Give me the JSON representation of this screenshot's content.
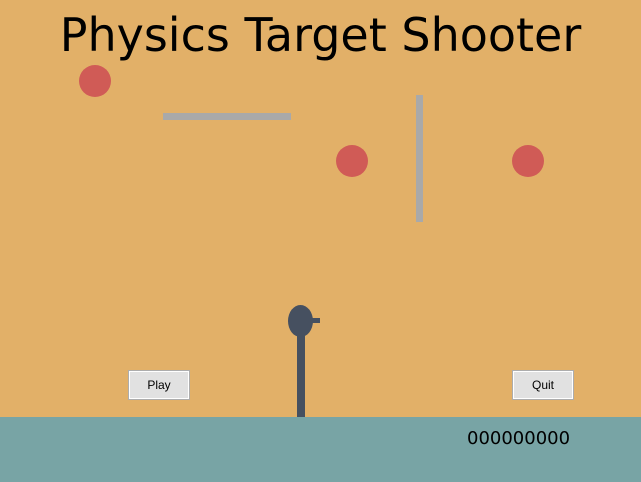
{
  "title": "Physics Target Shooter",
  "buttons": {
    "play_label": "Play",
    "quit_label": "Quit"
  },
  "score": "000000000",
  "colors": {
    "background": "#e2b068",
    "ground": "#78a4a5",
    "target": "#d05b56",
    "wall": "#a9a9a9",
    "cannon": "#465060"
  }
}
